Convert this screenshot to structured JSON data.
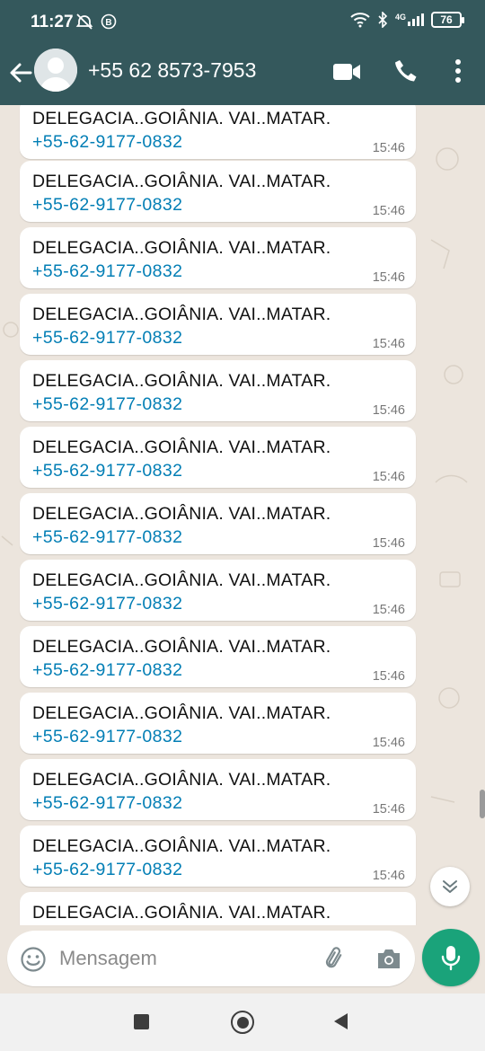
{
  "status_bar": {
    "time": "11:27",
    "network": "4G",
    "battery": "76"
  },
  "chat_header": {
    "contact_name": "+55 62 8573-7953"
  },
  "messages": [
    {
      "text": "DELEGACIA..GOIÂNIA. VAI..MATAR.",
      "link": "+55-62-9177-0832",
      "time": "15:46"
    },
    {
      "text": "DELEGACIA..GOIÂNIA. VAI..MATAR.",
      "link": "+55-62-9177-0832",
      "time": "15:46"
    },
    {
      "text": "DELEGACIA..GOIÂNIA. VAI..MATAR.",
      "link": "+55-62-9177-0832",
      "time": "15:46"
    },
    {
      "text": "DELEGACIA..GOIÂNIA. VAI..MATAR.",
      "link": "+55-62-9177-0832",
      "time": "15:46"
    },
    {
      "text": "DELEGACIA..GOIÂNIA. VAI..MATAR.",
      "link": "+55-62-9177-0832",
      "time": "15:46"
    },
    {
      "text": "DELEGACIA..GOIÂNIA. VAI..MATAR.",
      "link": "+55-62-9177-0832",
      "time": "15:46"
    },
    {
      "text": "DELEGACIA..GOIÂNIA. VAI..MATAR.",
      "link": "+55-62-9177-0832",
      "time": "15:46"
    },
    {
      "text": "DELEGACIA..GOIÂNIA. VAI..MATAR.",
      "link": "+55-62-9177-0832",
      "time": "15:46"
    },
    {
      "text": "DELEGACIA..GOIÂNIA. VAI..MATAR.",
      "link": "+55-62-9177-0832",
      "time": "15:46"
    },
    {
      "text": "DELEGACIA..GOIÂNIA. VAI..MATAR.",
      "link": "+55-62-9177-0832",
      "time": "15:46"
    },
    {
      "text": "DELEGACIA..GOIÂNIA. VAI..MATAR.",
      "link": "+55-62-9177-0832",
      "time": "15:46"
    },
    {
      "text": "DELEGACIA..GOIÂNIA. VAI..MATAR.",
      "link": "+55-62-9177-0832",
      "time": "15:46"
    },
    {
      "text": "DELEGACIA..GOIÂNIA. VAI..MATAR.",
      "link": "",
      "time": ""
    }
  ],
  "composer": {
    "placeholder": "Mensagem"
  },
  "colors": {
    "header": "#34585c",
    "chat_background": "#ece5dd",
    "link": "#027eb5",
    "mic_button": "#1aa37a"
  },
  "icons": {
    "back": "arrow-left-icon",
    "video": "video-camera-icon",
    "call": "phone-icon",
    "menu": "more-vertical-icon",
    "emoji": "emoji-icon",
    "attach": "paperclip-icon",
    "camera": "camera-icon",
    "mic": "microphone-icon",
    "scroll_down": "double-chevron-down-icon"
  }
}
